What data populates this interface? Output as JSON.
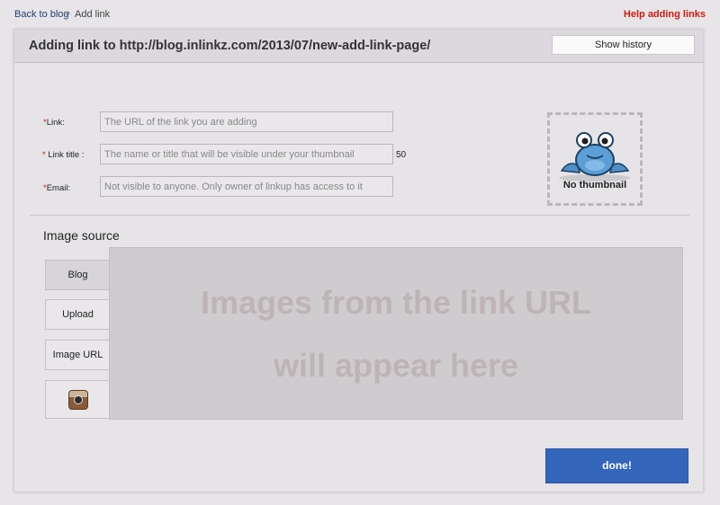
{
  "breadcrumb": {
    "back": "Back to blog",
    "separator": "»",
    "current": "Add link"
  },
  "help_link": "Help adding links",
  "header": {
    "title": "Adding link to http://blog.inlinkz.com/2013/07/new-add-link-page/",
    "history_button": "Show history"
  },
  "form": {
    "required_marker": "*",
    "link": {
      "label": "Link:",
      "placeholder": "The URL of the link you are adding",
      "value": ""
    },
    "title": {
      "label": " Link title :",
      "placeholder": "The name or title that will be visible under your thumbnail",
      "value": "",
      "char_count": "50"
    },
    "email": {
      "label": "Email:",
      "placeholder": "Not visible to anyone. Only owner of linkup has access to it",
      "value": ""
    }
  },
  "thumbnail": {
    "label": "No thumbnail",
    "icon": "frog-mascot-icon"
  },
  "image_source": {
    "title": "Image source",
    "tabs": [
      {
        "label": "Blog",
        "active": true
      },
      {
        "label": "Upload",
        "active": false
      },
      {
        "label": "Image URL",
        "active": false
      },
      {
        "label": "",
        "icon": "instagram-icon",
        "active": false
      }
    ],
    "placeholder_line1": "Images from the link URL",
    "placeholder_line2": "will appear here"
  },
  "done_button": "done!",
  "colors": {
    "accent": "#3366bb",
    "required": "#d21a10",
    "help_link": "#d21a10"
  }
}
